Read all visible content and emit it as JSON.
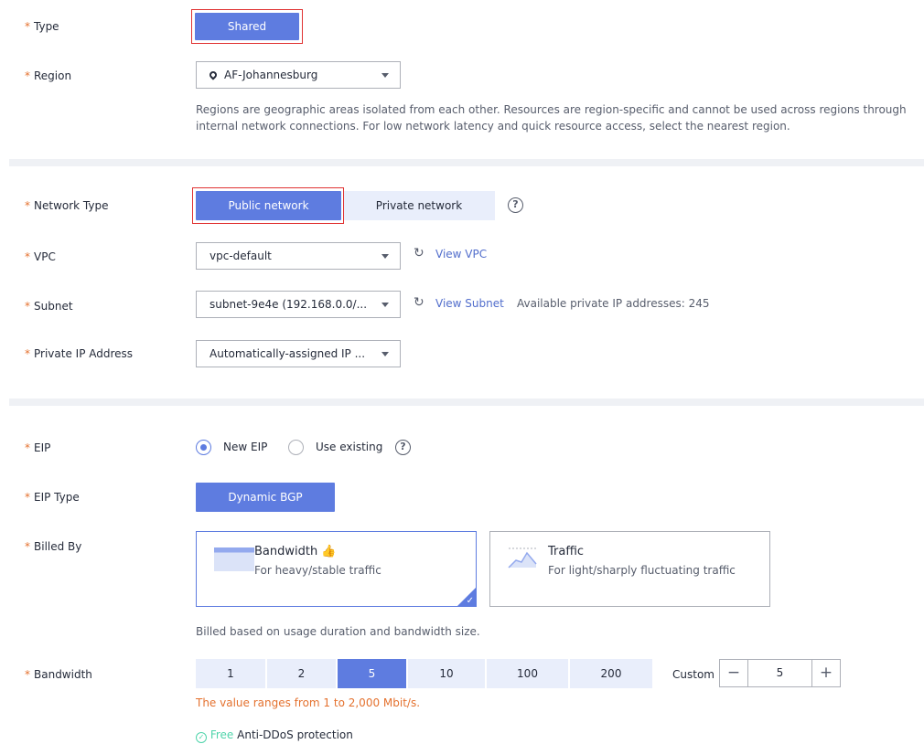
{
  "type": {
    "label": "Type",
    "option": "Shared"
  },
  "region": {
    "label": "Region",
    "value": "AF-Johannesburg",
    "help_line1": "Regions are geographic areas isolated from each other. Resources are region-specific and cannot be used across regions through",
    "help_line2": "internal network connections. For low network latency and quick resource access, select the nearest region."
  },
  "network_type": {
    "label": "Network Type",
    "options": [
      "Public network",
      "Private network"
    ],
    "selected": "Public network",
    "help": "?"
  },
  "vpc": {
    "label": "VPC",
    "value": "vpc-default",
    "link": "View VPC"
  },
  "subnet": {
    "label": "Subnet",
    "value": "subnet-9e4e (192.168.0.0/...",
    "link": "View Subnet",
    "note": "Available private IP addresses: 245"
  },
  "private_ip": {
    "label": "Private IP Address",
    "value": "Automatically-assigned IP ..."
  },
  "eip": {
    "label": "EIP",
    "options": [
      "New EIP",
      "Use existing"
    ],
    "selected": "New EIP",
    "help": "?"
  },
  "eip_type": {
    "label": "EIP Type",
    "option": "Dynamic BGP"
  },
  "billed_by": {
    "label": "Billed By",
    "cards": [
      {
        "title": "Bandwidth",
        "desc": "For heavy/stable traffic",
        "selected": true
      },
      {
        "title": "Traffic",
        "desc": "For light/sharply fluctuating traffic",
        "selected": false
      }
    ],
    "note": "Billed based on usage duration and bandwidth size."
  },
  "bandwidth": {
    "label": "Bandwidth",
    "options": [
      "1",
      "2",
      "5",
      "10",
      "100",
      "200"
    ],
    "selected": "5",
    "custom_label": "Custom",
    "minus": "−",
    "plus": "+",
    "value": "5",
    "range_note": "The value ranges from 1 to 2,000 Mbit/s."
  },
  "ddos": {
    "free": "Free",
    "text": "Anti-DDoS protection"
  },
  "colors": {
    "primary": "#5e7ce0",
    "required": "#e4712e",
    "warning": "#e4712e",
    "success": "#50d4ab",
    "highlight_box": "#e03232"
  }
}
